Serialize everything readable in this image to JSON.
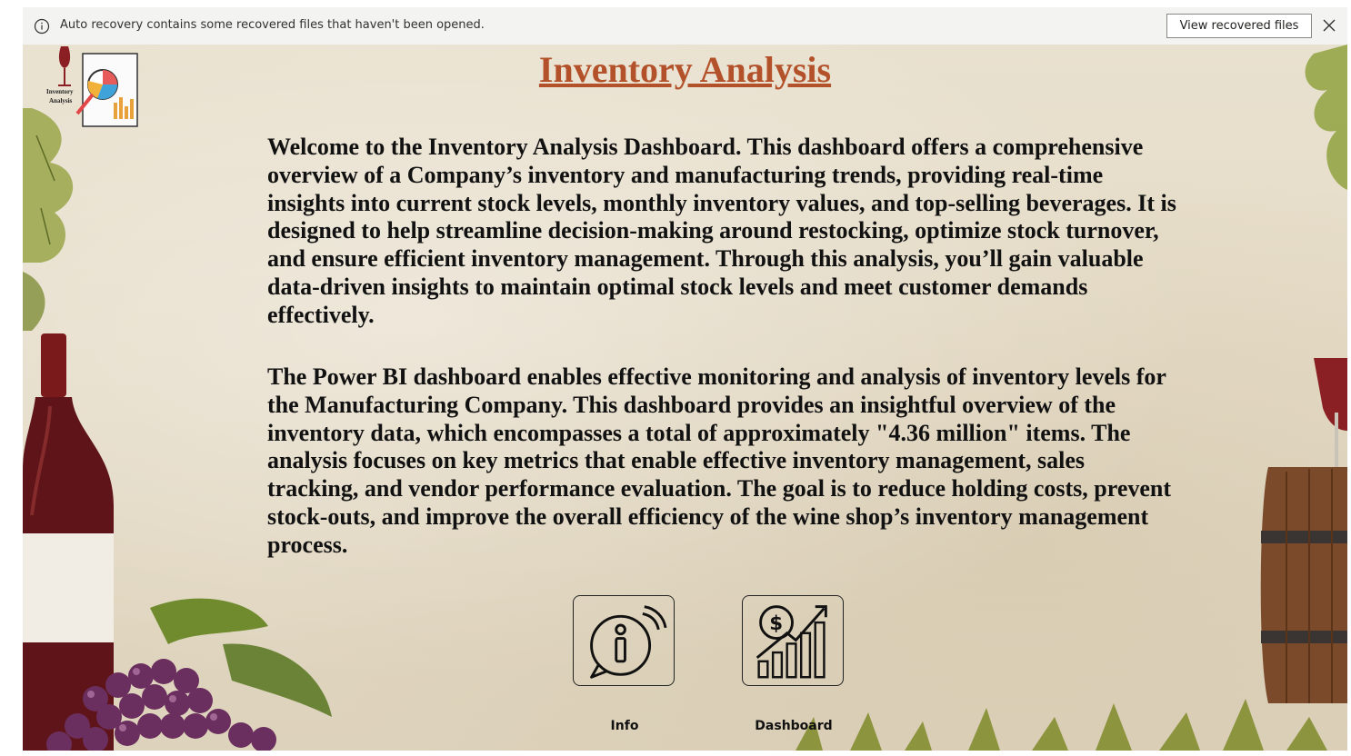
{
  "notification": {
    "message": "Auto recovery contains some recovered files that haven't been opened.",
    "button_label": "View recovered files"
  },
  "logo": {
    "text_line1": "Inventory",
    "text_line2": "Analysis"
  },
  "page": {
    "title": "Inventory Analysis",
    "paragraph1": "Welcome to the Inventory Analysis Dashboard. This dashboard offers a comprehensive overview of a Company’s inventory and manufacturing trends, providing real-time insights into current stock levels, monthly inventory values, and top-selling beverages. It is designed to help streamline decision-making around restocking, optimize stock turnover, and ensure efficient inventory management. Through this analysis, you’ll gain valuable data-driven insights to maintain optimal stock levels and meet customer demands effectively.",
    "paragraph2": "The Power BI dashboard enables effective monitoring and analysis of inventory levels for the Manufacturing Company. This dashboard provides an insightful overview of the inventory data, which encompasses a total of approximately \"4.36 million\" items. The analysis focuses on key metrics that enable effective inventory management, sales tracking, and vendor performance evaluation. The goal is to reduce holding costs, prevent stock-outs, and improve the overall efficiency of the wine shop’s inventory management process."
  },
  "nav": {
    "info_label": "Info",
    "dashboard_label": "Dashboard"
  },
  "colors": {
    "title": "#b3512a",
    "background": "#e6ddc9"
  },
  "icons": {
    "info": "info-chat-icon",
    "dashboard": "dollar-growth-chart-icon",
    "close": "close-icon",
    "notice": "info-circle-icon"
  }
}
